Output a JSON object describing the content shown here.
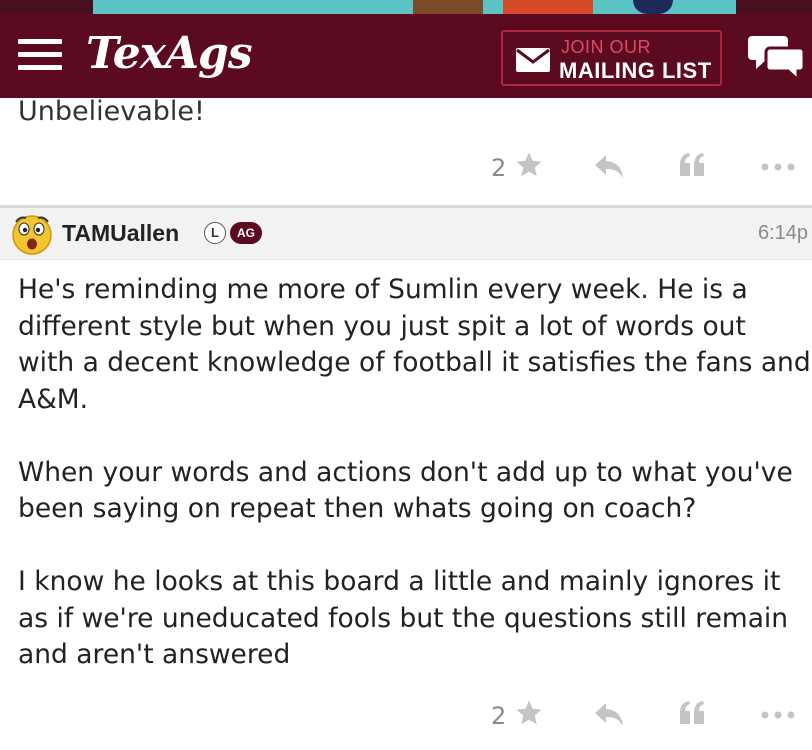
{
  "header": {
    "logo": "TexAgs",
    "mailing_list": {
      "line1": "JOIN OUR",
      "line2": "MAILING LIST"
    },
    "icons": {
      "menu": "hamburger-menu-icon",
      "envelope": "envelope-icon",
      "chat": "chat-bubbles-icon"
    }
  },
  "prev_post": {
    "text_tail": "Unbelievable!",
    "star_count": "2"
  },
  "post": {
    "username": "TAMUallen",
    "badge_l": "L",
    "badge_ag": "AG",
    "time": "6:14p",
    "paragraphs": [
      "He's reminding me more of Sumlin every week. He is a\ndifferent style but when you just spit a lot of words out\nwith a decent knowledge of football it satisfies the fans and\nA&M.",
      "When your words and actions don't add up to what you've\nbeen saying on repeat then whats going on coach?",
      "I know he looks at this board a little and mainly ignores it\nas if we're uneducated fools but the questions still remain\nand aren't answered"
    ],
    "star_count": "2"
  },
  "colors": {
    "brand_maroon": "#5c0a1f",
    "accent_pink": "#e04a64",
    "icon_gray": "#b8b8b8",
    "header_bar_gray": "#f2f2f2"
  }
}
